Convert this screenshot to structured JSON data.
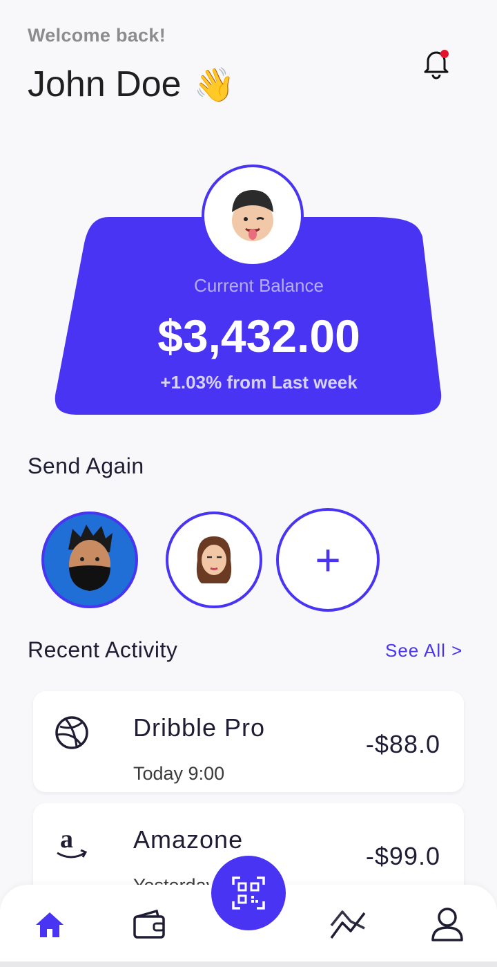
{
  "header": {
    "welcome": "Welcome back!",
    "name": "John Doe",
    "wave_emoji": "👋",
    "notification_icon": "bell-icon",
    "has_unread_notification": true
  },
  "balance_card": {
    "label": "Current Balance",
    "amount": "$3,432.00",
    "change": "+1.03% from Last week",
    "accent_color": "#4834f2"
  },
  "send_again": {
    "title": "Send Again",
    "contacts": [
      {
        "avatar": "memoji-man-mask-avatar"
      },
      {
        "avatar": "memoji-woman-avatar"
      }
    ],
    "add_label": "+"
  },
  "recent_activity": {
    "title": "Recent Activity",
    "see_all": "See All >",
    "items": [
      {
        "icon": "dribbble-icon",
        "name": "Dribble Pro",
        "time": "Today 9:00",
        "amount": "-$88.0"
      },
      {
        "icon": "amazon-icon",
        "name": "Amazone",
        "time": "Yesterday",
        "amount": "-$99.0"
      }
    ]
  },
  "bottom_nav": {
    "items": [
      "home-icon",
      "wallet-icon",
      "qr-scan-icon",
      "stats-icon",
      "profile-icon"
    ],
    "active": "home-icon"
  }
}
